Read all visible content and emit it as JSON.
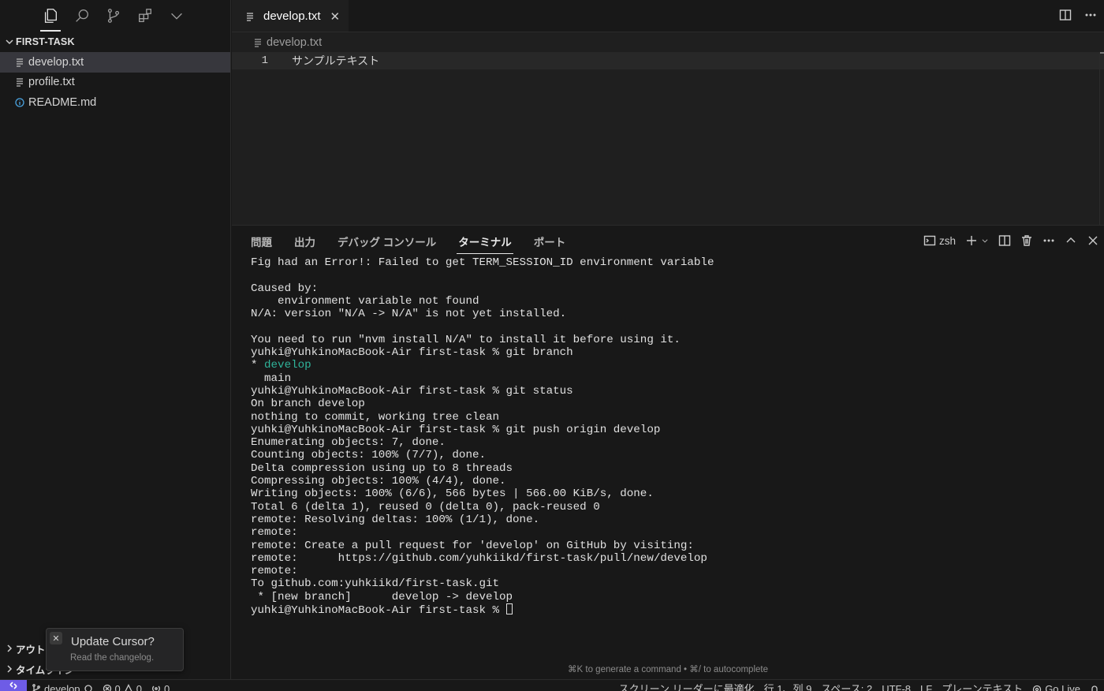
{
  "explorer": {
    "title": "FIRST-TASK",
    "files": [
      {
        "name": "develop.txt",
        "icon": "text-file-icon"
      },
      {
        "name": "profile.txt",
        "icon": "text-file-icon"
      },
      {
        "name": "README.md",
        "icon": "info-icon"
      }
    ],
    "outline_label": "アウト",
    "timeline_label": "タイムライン"
  },
  "toast": {
    "title": "Update Cursor?",
    "subtitle": "Read the changelog.",
    "close_glyph": "✕"
  },
  "editor": {
    "tab_label": "develop.txt",
    "tab_close": "✕",
    "breadcrumb": "develop.txt",
    "lines": [
      {
        "number": "1",
        "text": "サンプルテキスト"
      }
    ]
  },
  "panel": {
    "tabs": [
      "問題",
      "出力",
      "デバッグ コンソール",
      "ターミナル",
      "ポート"
    ],
    "active_tab": "ターミナル",
    "shell_label": "zsh",
    "hint": "⌘K to generate a command • ⌘/ to autocomplete",
    "terminal_lines": [
      "Fig had an Error!: Failed to get TERM_SESSION_ID environment variable",
      "",
      "Caused by:",
      "    environment variable not found",
      "N/A: version \"N/A -> N/A\" is not yet installed.",
      "",
      "You need to run \"nvm install N/A\" to install it before using it.",
      "yuhki@YuhkinoMacBook-Air first-task % git branch",
      "* develop",
      "  main",
      "yuhki@YuhkinoMacBook-Air first-task % git status",
      "On branch develop",
      "nothing to commit, working tree clean",
      "yuhki@YuhkinoMacBook-Air first-task % git push origin develop",
      "Enumerating objects: 7, done.",
      "Counting objects: 100% (7/7), done.",
      "Delta compression using up to 8 threads",
      "Compressing objects: 100% (4/4), done.",
      "Writing objects: 100% (6/6), 566 bytes | 566.00 KiB/s, done.",
      "Total 6 (delta 1), reused 0 (delta 0), pack-reused 0",
      "remote: Resolving deltas: 100% (1/1), done.",
      "remote:",
      "remote: Create a pull request for 'develop' on GitHub by visiting:",
      "remote:      https://github.com/yuhkiikd/first-task/pull/new/develop",
      "remote:",
      "To github.com:yuhkiikd/first-task.git",
      " * [new branch]      develop -> develop",
      "yuhki@YuhkinoMacBook-Air first-task % "
    ],
    "highlight_line_index": 8,
    "highlight_color": "#2fb39a"
  },
  "statusbar": {
    "branch": "develop",
    "errors": "0",
    "warnings": "0",
    "ports": "0",
    "screen_reader": "スクリーン リーダーに最適化",
    "position": "行 1、列 9",
    "spaces": "スペース: 2",
    "encoding": "UTF-8",
    "eol": "LF",
    "language": "プレーンテキスト",
    "go_live": "Go Live"
  },
  "colors": {
    "accent": "#6e5ce6",
    "background": "#181818",
    "editor_bg": "#1f1f1f"
  }
}
